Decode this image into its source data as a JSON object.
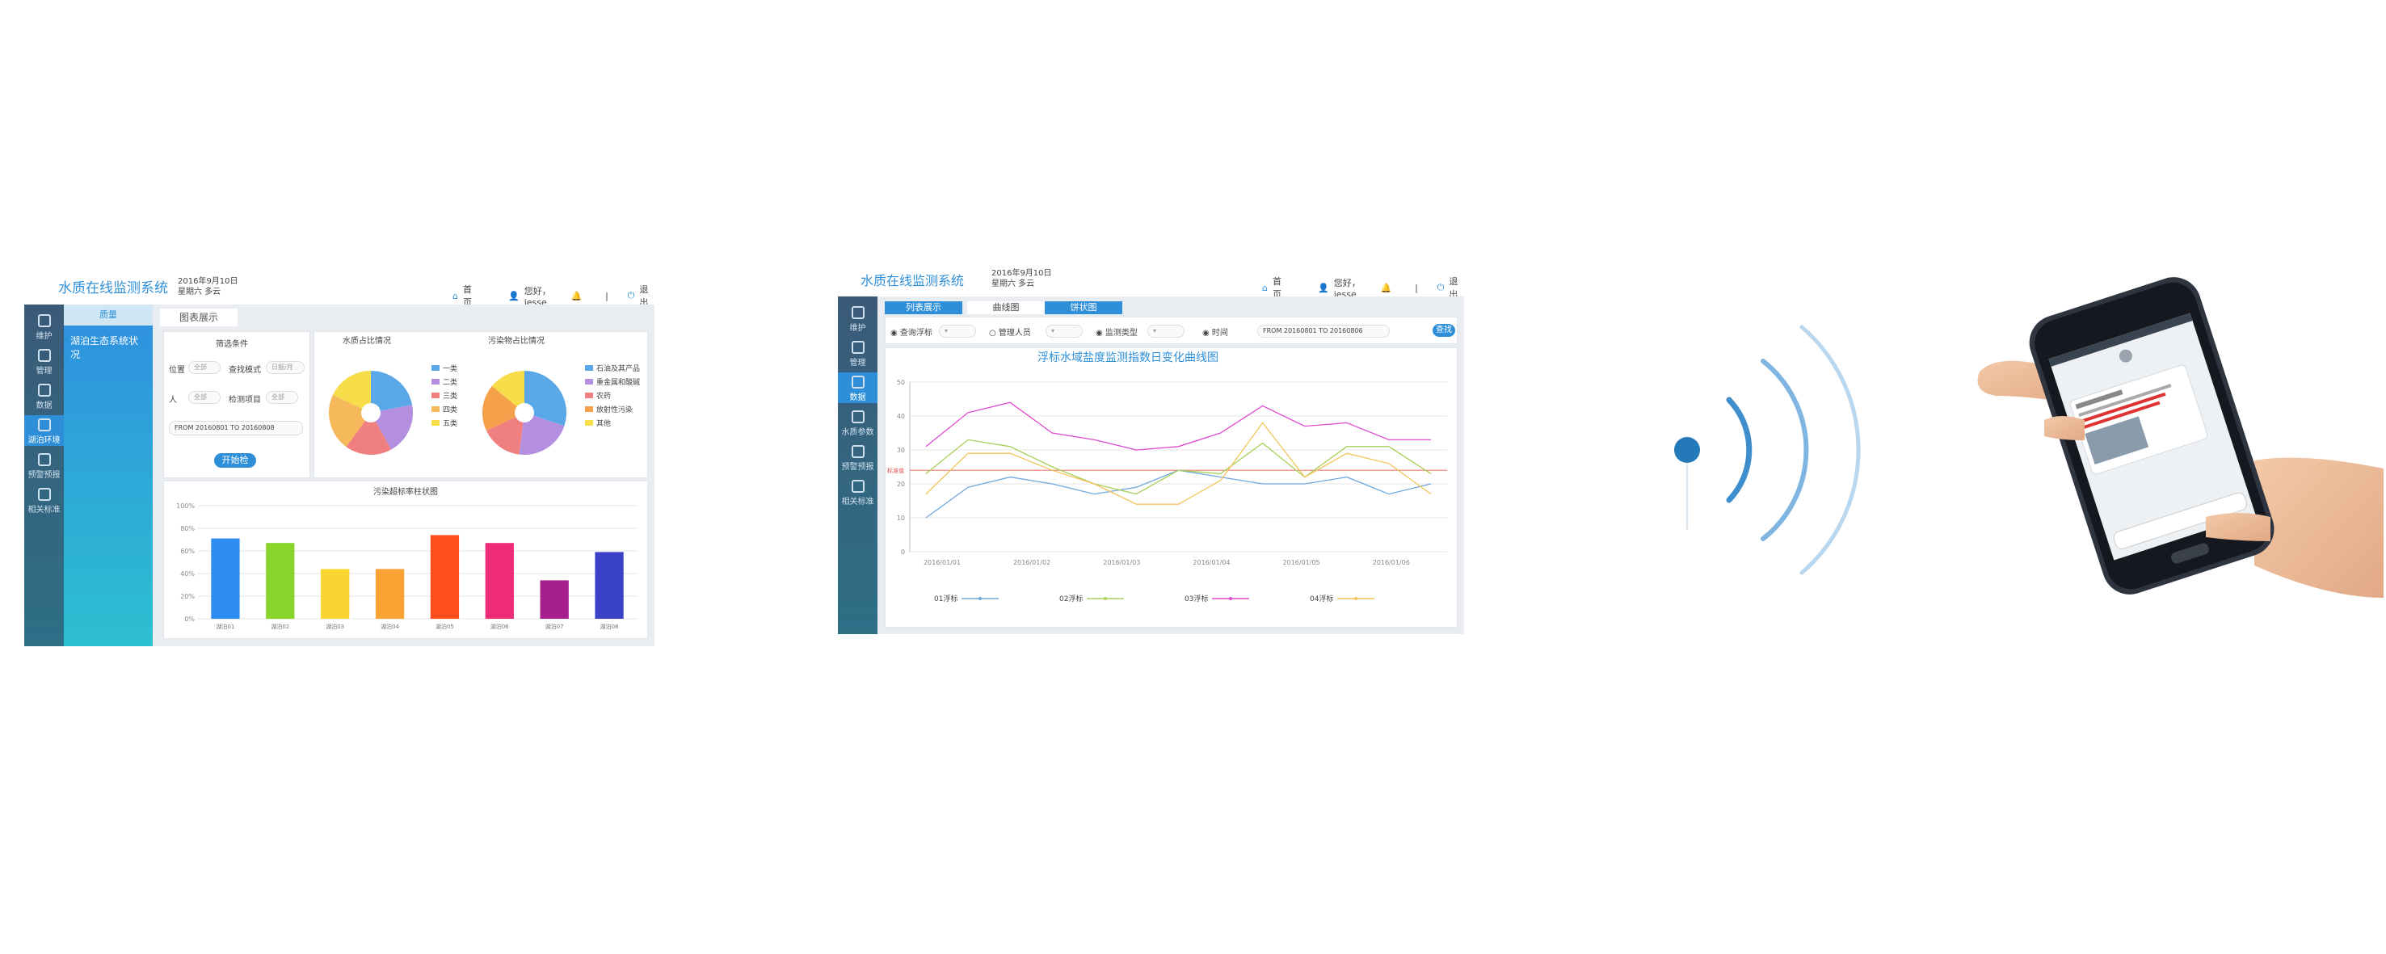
{
  "app1": {
    "title": "水质在线监测系统",
    "date_line1": "2016年9月10日",
    "date_line2": "星期六 多云",
    "nav_home": "首页",
    "nav_user": "您好，jesse",
    "nav_logout": "退出",
    "sidebar": [
      {
        "label": "维护",
        "icon": "wrench-icon"
      },
      {
        "label": "管理",
        "icon": "manage-icon"
      },
      {
        "label": "数据",
        "icon": "chart-icon"
      },
      {
        "label": "湖泊环境",
        "icon": "lake-icon",
        "active": true
      },
      {
        "label": "预警预报",
        "icon": "alert-icon"
      },
      {
        "label": "相关标准",
        "icon": "standard-icon"
      }
    ],
    "subnav_header": "质量",
    "subnav_item": "湖泊生态系统状况",
    "tab_label": "图表展示",
    "filter": {
      "title": "筛选条件",
      "position_label": "位置",
      "position_value": "全部",
      "mode_label": "查找模式",
      "mode_value": "日报/月",
      "person_label": "人",
      "person_value": "全部",
      "item_label": "检测项目",
      "item_value": "全部",
      "date_range": "FROM 20160801      TO 20160808",
      "start_button": "开始检"
    },
    "pie1": {
      "title": "水质占比情况",
      "legend": [
        "一类",
        "二类",
        "三类",
        "四类",
        "五类"
      ],
      "values": [
        22,
        20,
        18,
        22,
        18
      ],
      "colors": [
        "#5aa8e8",
        "#b48fe0",
        "#f08080",
        "#f5b85a",
        "#f7dd4a"
      ]
    },
    "pie2": {
      "title": "污染物占比情况",
      "legend": [
        "石油及其产品",
        "重金属和酸碱",
        "农药",
        "放射性污染",
        "其他"
      ],
      "values": [
        30,
        22,
        16,
        18,
        14
      ],
      "colors": [
        "#5aa8e8",
        "#b48fe0",
        "#f08080",
        "#f5a04a",
        "#f7dd4a"
      ]
    },
    "chart_data": {
      "type": "bar",
      "title": "污染超标率柱状图",
      "categories": [
        "湖泊01",
        "湖泊02",
        "湖泊03",
        "湖泊04",
        "湖泊05",
        "湖泊06",
        "湖泊07",
        "湖泊08"
      ],
      "values": [
        71,
        67,
        44,
        44,
        74,
        67,
        34,
        59
      ],
      "colors": [
        "#2d8ef0",
        "#8ad42c",
        "#f9d533",
        "#fba234",
        "#ff4e1c",
        "#ee2c78",
        "#a6208c",
        "#3a43c8"
      ],
      "yticks": [
        "0%",
        "20%",
        "40%",
        "60%",
        "80%",
        "100%"
      ],
      "ylim": [
        0,
        100
      ]
    }
  },
  "app2": {
    "title": "水质在线监测系统",
    "date_line1": "2016年9月10日",
    "date_line2": "星期六 多云",
    "nav_home": "首页",
    "nav_user": "您好，jesse",
    "nav_logout": "退出",
    "sidebar": [
      {
        "label": "维护",
        "icon": "wrench-icon"
      },
      {
        "label": "管理",
        "icon": "manage-icon"
      },
      {
        "label": "数据",
        "icon": "chart-icon",
        "active": true
      },
      {
        "label": "水质参数",
        "icon": "param-icon"
      },
      {
        "label": "预警预报",
        "icon": "alert-icon"
      },
      {
        "label": "相关标准",
        "icon": "standard-icon"
      }
    ],
    "tabs": [
      "列表展示",
      "曲线图",
      "饼状图"
    ],
    "filters": {
      "f1": "查询浮标",
      "f2": "管理人员",
      "f3": "监测类型",
      "f4": "时间",
      "date_range": "FROM 20160801    TO 20160806",
      "search": "查找"
    },
    "chart_data": {
      "type": "line",
      "title": "浮标水域盐度监测指数日变化曲线图",
      "x": [
        "2016/01/01",
        "2016/01/02",
        "2016/01/03",
        "2016/01/04",
        "2016/01/05",
        "2016/01/06"
      ],
      "yticks": [
        "0",
        "10",
        "20",
        "30",
        "40",
        "50"
      ],
      "ylim": [
        0,
        50
      ],
      "threshold_label": "标准值",
      "threshold": 24,
      "series": [
        {
          "name": "01浮标",
          "color": "#6fa8dc",
          "values": [
            10,
            19,
            22,
            20,
            17,
            19,
            24,
            22,
            20,
            20,
            22,
            17,
            20
          ]
        },
        {
          "name": "02浮标",
          "color": "#a8cf5a",
          "values": [
            23,
            33,
            31,
            25,
            20,
            17,
            24,
            23,
            32,
            22,
            31,
            31,
            23
          ]
        },
        {
          "name": "03浮标",
          "color": "#e04ad0",
          "values": [
            31,
            41,
            44,
            35,
            33,
            30,
            31,
            35,
            43,
            37,
            38,
            33,
            33
          ]
        },
        {
          "name": "04浮标",
          "color": "#f2c45a",
          "values": [
            17,
            29,
            29,
            24,
            20,
            14,
            14,
            21,
            38,
            22,
            29,
            26,
            17
          ]
        }
      ]
    }
  }
}
